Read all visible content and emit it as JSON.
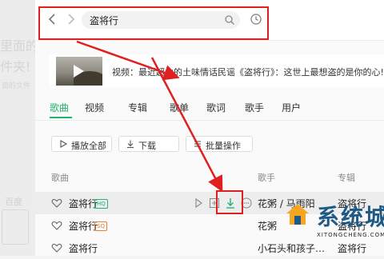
{
  "background_hint": {
    "line1": "里面的",
    "line2": "件夹!",
    "line3": "面的文件",
    "line4": "百度"
  },
  "toolbar": {
    "back_icon": "chevron-left-icon",
    "forward_icon": "chevron-right-icon",
    "search_value": "盗将行",
    "search_icon": "search-icon",
    "history_icon": "clock-icon"
  },
  "video_banner": {
    "text": "视频：最近超火的土味情话民谣《盗将行》：这世上最想盗的是你的心!"
  },
  "tabs": [
    "歌曲",
    "视频",
    "专辑",
    "歌单",
    "歌词",
    "歌手",
    "用户"
  ],
  "actions": {
    "play_all": "播放全部",
    "download": "下载",
    "batch": "批量操作"
  },
  "columns": {
    "song": "歌曲",
    "singer": "歌手",
    "album": "专辑"
  },
  "songs": [
    {
      "title": "盗将行",
      "quality": "HQ",
      "singer": "花粥 / 马雨阳",
      "album": "盗将行"
    },
    {
      "title": "盗将行",
      "quality": "SQ",
      "singer": "花粥",
      "album": "盗将行"
    },
    {
      "title": "盗将行",
      "quality": "",
      "singer": "小石头和孩子…",
      "album": "盗将行"
    }
  ],
  "colors": {
    "accent": "#21b571",
    "annotation": "#e02020",
    "hq_badge": "#21b571",
    "sq_badge": "#f0802b"
  },
  "watermark": {
    "cn": "系统城",
    "en": "XITONGCHENG.COM"
  }
}
